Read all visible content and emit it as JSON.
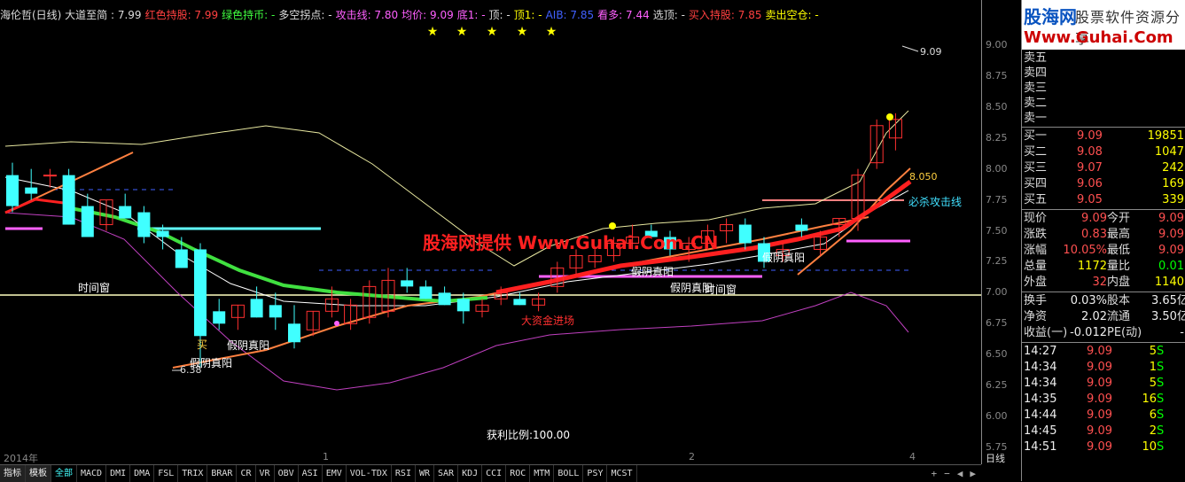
{
  "top_info": [
    {
      "text": "海伦哲(日线) 大道至简 : 7.99",
      "color": "#dddddd"
    },
    {
      "text": "红色持股: 7.99",
      "color": "#ff4040"
    },
    {
      "text": "绿色持币: -",
      "color": "#40ff40"
    },
    {
      "text": "多空拐点: -",
      "color": "#dddddd"
    },
    {
      "text": "攻击线: 7.80",
      "color": "#ff60ff"
    },
    {
      "text": "均价: 9.09",
      "color": "#ff60ff"
    },
    {
      "text": "底1: -",
      "color": "#ff60ff"
    },
    {
      "text": "顶: -",
      "color": "#dddddd"
    },
    {
      "text": "顶1: -",
      "color": "#ffff00"
    },
    {
      "text": "AIB: 7.85",
      "color": "#4060ff"
    },
    {
      "text": "看多: 7.44",
      "color": "#ff60ff"
    },
    {
      "text": "选顶: -",
      "color": "#dddddd"
    },
    {
      "text": "买入持股: 7.85",
      "color": "#ff4040"
    },
    {
      "text": "卖出空仓: -",
      "color": "#ffff00"
    }
  ],
  "y_axis": [
    "9.00",
    "8.75",
    "8.50",
    "8.25",
    "8.00",
    "7.75",
    "7.50",
    "7.25",
    "7.00",
    "6.75",
    "6.50",
    "6.25",
    "6.00",
    "5.75"
  ],
  "x_axis": [
    "2014年",
    "1",
    "2",
    "4"
  ],
  "period_label": "日线",
  "annotations": {
    "high": "9.09",
    "low": "6.38",
    "level": "8.050",
    "must_kill": "必杀攻击线",
    "watermark": "股海网提供 Www.Guhai.Com.CN",
    "time_window": "时间窗",
    "fake_yin": "假阴真阳",
    "buy": "买",
    "big_money": "大资金进场",
    "profit_ratio": "获利比例:100.00"
  },
  "tabs": [
    "指标",
    "模板",
    "全部",
    "MACD",
    "DMI",
    "DMA",
    "FSL",
    "TRIX",
    "BRAR",
    "CR",
    "VR",
    "OBV",
    "ASI",
    "EMV",
    "VOL-TDX",
    "RSI",
    "WR",
    "SAR",
    "KDJ",
    "CCI",
    "ROC",
    "MTM",
    "BOLL",
    "PSY",
    "MCST"
  ],
  "logo": {
    "name": "股海网",
    "slogan": "股票软件资源分享",
    "url": "Www.Guhai.Com"
  },
  "sell_levels": [
    "卖五",
    "卖四",
    "卖三",
    "卖二",
    "卖一"
  ],
  "buy_levels": [
    {
      "label": "买一",
      "price": "9.09",
      "vol": "19851"
    },
    {
      "label": "买二",
      "price": "9.08",
      "vol": "1047"
    },
    {
      "label": "买三",
      "price": "9.07",
      "vol": "242"
    },
    {
      "label": "买四",
      "price": "9.06",
      "vol": "169"
    },
    {
      "label": "买五",
      "price": "9.05",
      "vol": "339"
    }
  ],
  "quote": [
    {
      "l1": "现价",
      "v1": "9.09",
      "c1": "#ff5050",
      "l2": "今开",
      "v2": "9.09",
      "c2": "#ff5050"
    },
    {
      "l1": "涨跌",
      "v1": "0.83",
      "c1": "#ff5050",
      "l2": "最高",
      "v2": "9.09",
      "c2": "#ff5050"
    },
    {
      "l1": "涨幅",
      "v1": "10.05%",
      "c1": "#ff5050",
      "l2": "最低",
      "v2": "9.09",
      "c2": "#ff5050"
    },
    {
      "l1": "总量",
      "v1": "1172",
      "c1": "#ffff00",
      "l2": "量比",
      "v2": "0.01",
      "c2": "#00ff00"
    },
    {
      "l1": "外盘",
      "v1": "32",
      "c1": "#ff5050",
      "l2": "内盘",
      "v2": "1140",
      "c2": "#ffff00"
    }
  ],
  "fundamentals": [
    {
      "l1": "换手",
      "v1": "0.03%",
      "l2": "股本",
      "v2": "3.65亿"
    },
    {
      "l1": "净资",
      "v1": "2.02",
      "l2": "流通",
      "v2": "3.50亿"
    },
    {
      "l1": "收益(一)",
      "v1": "-0.012",
      "l2": "PE(动)",
      "v2": "-"
    }
  ],
  "ticks": [
    {
      "time": "14:27",
      "price": "9.09",
      "vol": "5",
      "side": "S"
    },
    {
      "time": "14:34",
      "price": "9.09",
      "vol": "1",
      "side": "S"
    },
    {
      "time": "14:34",
      "price": "9.09",
      "vol": "5",
      "side": "S"
    },
    {
      "time": "14:35",
      "price": "9.09",
      "vol": "16",
      "side": "S"
    },
    {
      "time": "14:44",
      "price": "9.09",
      "vol": "6",
      "side": "S"
    },
    {
      "time": "14:45",
      "price": "9.09",
      "vol": "2",
      "side": "S"
    },
    {
      "time": "14:51",
      "price": "9.09",
      "vol": "10",
      "side": "S"
    }
  ],
  "colors": {
    "up": "#ff3030",
    "down": "#40ffff",
    "ma_green": "#40e040",
    "ma_red": "#ff2020",
    "boll_upper": "#e8e8a0",
    "boll_lower": "#c040c0",
    "attack_line": "#ff8040"
  },
  "chart_data": {
    "type": "candlestick",
    "ylim": [
      5.75,
      9.15
    ],
    "series": [
      {
        "name": "K线",
        "ohlc": [
          [
            7.95,
            8.05,
            7.65,
            7.7
          ],
          [
            7.85,
            8.0,
            7.75,
            7.8
          ],
          [
            7.95,
            8.0,
            7.85,
            7.95
          ],
          [
            7.95,
            8.0,
            7.55,
            7.55
          ],
          [
            7.7,
            7.8,
            7.45,
            7.45
          ],
          [
            7.55,
            7.75,
            7.5,
            7.75
          ],
          [
            7.7,
            7.8,
            7.6,
            7.6
          ],
          [
            7.65,
            7.7,
            7.4,
            7.45
          ],
          [
            7.5,
            7.55,
            7.35,
            7.45
          ],
          [
            7.35,
            7.45,
            7.2,
            7.2
          ],
          [
            7.35,
            7.4,
            6.4,
            6.65
          ],
          [
            6.85,
            6.95,
            6.7,
            6.75
          ],
          [
            6.8,
            6.9,
            6.7,
            6.9
          ],
          [
            6.95,
            7.05,
            6.8,
            6.8
          ],
          [
            6.9,
            7.0,
            6.7,
            6.8
          ],
          [
            6.75,
            6.9,
            6.55,
            6.6
          ],
          [
            6.7,
            6.85,
            6.65,
            6.85
          ],
          [
            6.85,
            7.05,
            6.8,
            6.95
          ],
          [
            6.75,
            6.95,
            6.7,
            6.9
          ],
          [
            6.8,
            7.1,
            6.75,
            7.05
          ],
          [
            6.85,
            7.2,
            6.8,
            7.1
          ],
          [
            7.1,
            7.2,
            7.0,
            7.05
          ],
          [
            7.05,
            7.1,
            6.95,
            6.95
          ],
          [
            7.0,
            7.05,
            6.9,
            6.9
          ],
          [
            6.95,
            7.0,
            6.75,
            6.85
          ],
          [
            6.85,
            6.95,
            6.8,
            6.9
          ],
          [
            6.95,
            7.05,
            6.9,
            7.0
          ],
          [
            6.95,
            7.0,
            6.9,
            6.9
          ],
          [
            6.9,
            7.0,
            6.85,
            6.95
          ],
          [
            7.05,
            7.25,
            7.0,
            7.2
          ],
          [
            7.2,
            7.35,
            7.15,
            7.3
          ],
          [
            7.25,
            7.35,
            7.2,
            7.3
          ],
          [
            7.3,
            7.45,
            7.25,
            7.4
          ],
          [
            7.4,
            7.55,
            7.35,
            7.45
          ],
          [
            7.5,
            7.55,
            7.45,
            7.45
          ],
          [
            7.45,
            7.5,
            7.3,
            7.35
          ],
          [
            7.35,
            7.45,
            7.25,
            7.4
          ],
          [
            7.4,
            7.55,
            7.35,
            7.5
          ],
          [
            7.5,
            7.6,
            7.4,
            7.55
          ],
          [
            7.55,
            7.6,
            7.35,
            7.4
          ],
          [
            7.4,
            7.45,
            7.2,
            7.25
          ],
          [
            7.3,
            7.4,
            7.25,
            7.35
          ],
          [
            7.55,
            7.6,
            7.45,
            7.5
          ],
          [
            7.35,
            7.5,
            7.3,
            7.45
          ],
          [
            7.55,
            7.6,
            7.45,
            7.6
          ],
          [
            7.6,
            8.0,
            7.5,
            7.95
          ],
          [
            8.05,
            8.4,
            8.0,
            8.35
          ],
          [
            8.25,
            8.45,
            8.15,
            8.4
          ]
        ]
      }
    ],
    "title": "海伦哲(日线)"
  }
}
